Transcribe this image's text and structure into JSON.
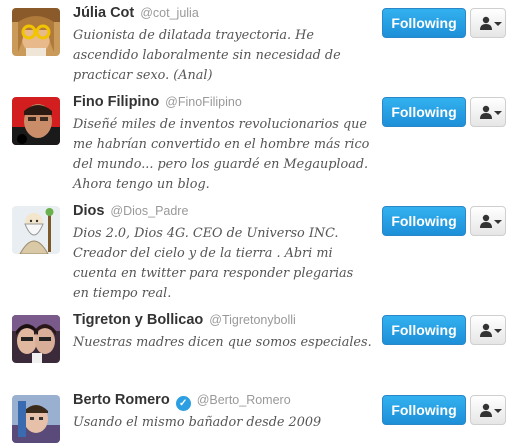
{
  "users": [
    {
      "name": "Júlia Cot",
      "handle": "@cot_julia",
      "verified": false,
      "bio": "Guionista de dilatada trayectoria. He ascendido laboralmente sin necesidad de practicar sexo. (Anal)",
      "follow_label": "Following"
    },
    {
      "name": "Fino Filipino",
      "handle": "@FinoFilipino",
      "verified": false,
      "bio": "Diseñé miles de inventos revolucionarios que me habrían convertido en el hombre más rico del mundo... pero los guardé en Megaupload. Ahora tengo un blog.",
      "follow_label": "Following"
    },
    {
      "name": "Dios",
      "handle": "@Dios_Padre",
      "verified": false,
      "bio": "Dios 2.0, Dios 4G. CEO de Universo INC. Creador del cielo y de la tierra . Abri mi cuenta en twitter para responder plegarias en tiempo real.",
      "follow_label": "Following"
    },
    {
      "name": "Tigreton y Bollicao",
      "handle": "@Tigretonybolli",
      "verified": false,
      "bio": "Nuestras madres dicen que somos especiales.",
      "follow_label": "Following"
    },
    {
      "name": "Berto Romero",
      "handle": "@Berto_Romero",
      "verified": true,
      "bio": "Usando el mismo bañador desde 2009",
      "follow_label": "Following"
    }
  ]
}
